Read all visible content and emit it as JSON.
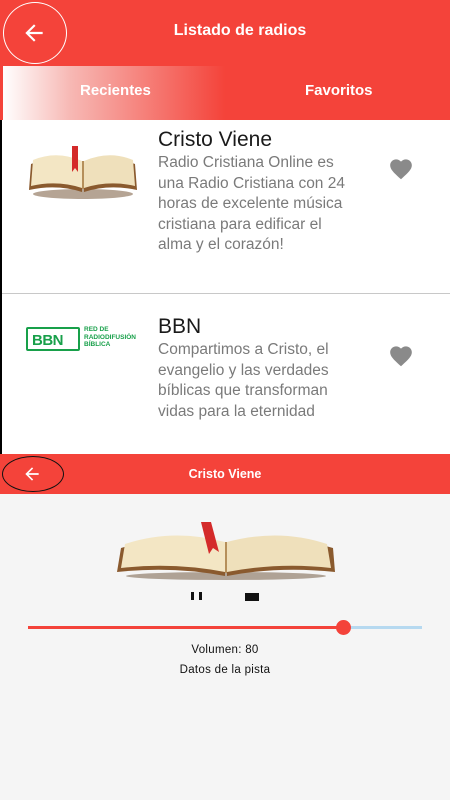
{
  "header": {
    "title": "Listado de radios"
  },
  "tabs": [
    {
      "label": "Recientes",
      "active": true
    },
    {
      "label": "Favoritos",
      "active": false
    }
  ],
  "stations": [
    {
      "name": "Cristo Viene",
      "description": "Radio Cristiana Online es una Radio Cristiana con 24 horas de excelente música cristiana para edificar el alma y el corazón!",
      "logo": "open-book-icon"
    },
    {
      "name": "BBN",
      "description": "Compartimos a Cristo, el evangelio y las verdades bíblicas que transforman vidas para la eternidad",
      "logo": "bbn-logo",
      "logo_text": "BBN",
      "logo_subtext": "RED DE RADIODIFUSIÓN BÍBLICA"
    }
  ],
  "player": {
    "title": "Cristo Viene",
    "volume_label": "Volumen: 80",
    "volume": 80,
    "track_info": "Datos de la pista"
  },
  "colors": {
    "accent": "#f4433a",
    "heart": "#8a8a8a",
    "bbn_green": "#18a04a",
    "slider_track": "#b6d9f0"
  }
}
